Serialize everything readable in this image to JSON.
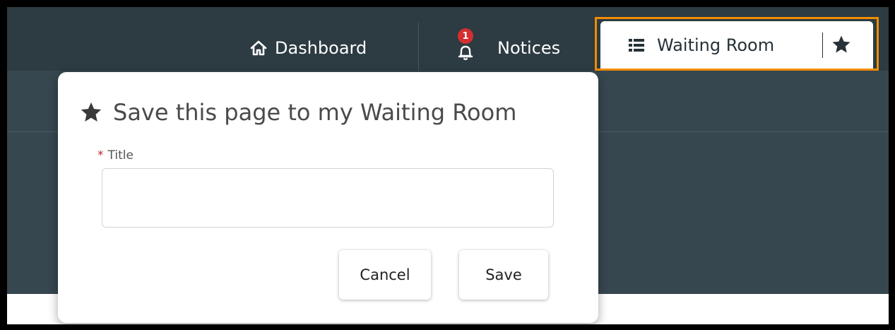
{
  "nav": {
    "dashboard_label": "Dashboard",
    "notices_label": "Notices",
    "notices_badge": "1",
    "waiting_room_label": "Waiting Room"
  },
  "modal": {
    "title": "Save this page to my Waiting Room",
    "field_required_marker": "*",
    "field_label": "Title",
    "field_value": "",
    "cancel_label": "Cancel",
    "save_label": "Save"
  },
  "colors": {
    "topbar": "#2d3b42",
    "subbar": "#37474f",
    "highlight": "#f08c00",
    "badge": "#d32f2f",
    "required": "#c62828"
  },
  "icons": {
    "dashboard": "home-icon",
    "notices": "bell-icon",
    "waiting_room": "list-icon",
    "favorite": "star-icon",
    "modal": "star-icon"
  }
}
